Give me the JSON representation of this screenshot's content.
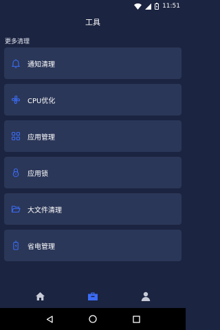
{
  "status_bar": {
    "time": "11:51"
  },
  "header": {
    "title": "工具"
  },
  "section": {
    "label": "更多清理"
  },
  "items": [
    {
      "label": "通知清理",
      "icon": "bell-icon"
    },
    {
      "label": "CPU优化",
      "icon": "fan-icon"
    },
    {
      "label": "应用管理",
      "icon": "apps-grid-icon"
    },
    {
      "label": "应用锁",
      "icon": "lock-icon"
    },
    {
      "label": "大文件清理",
      "icon": "folder-icon"
    },
    {
      "label": "省电管理",
      "icon": "battery-icon"
    }
  ],
  "bottom_nav": {
    "items": [
      {
        "icon": "home-icon",
        "active": false
      },
      {
        "icon": "toolbox-icon",
        "active": true
      },
      {
        "icon": "user-icon",
        "active": false
      }
    ]
  },
  "colors": {
    "background": "#1b2440",
    "card": "#2b3758",
    "accent": "#3b6cf6",
    "icon_inactive": "#c7cbd6"
  }
}
